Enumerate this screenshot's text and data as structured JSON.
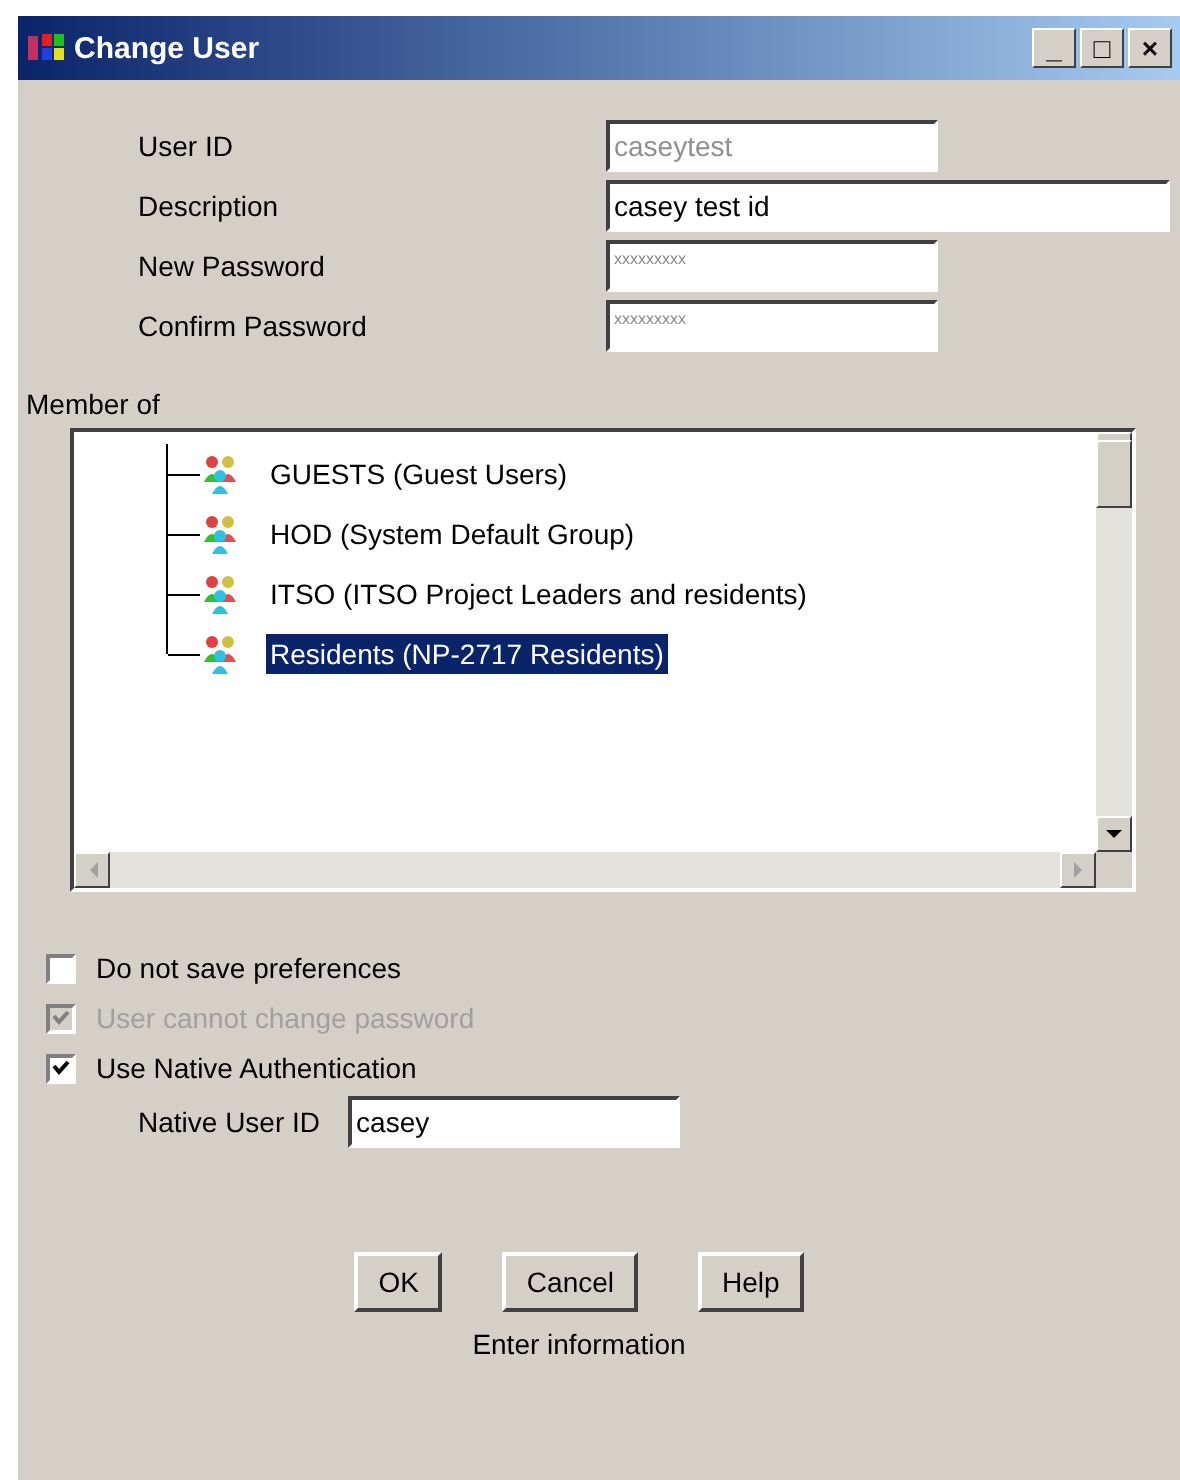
{
  "window": {
    "title": "Change User",
    "controls": [
      "_",
      "□",
      "×"
    ]
  },
  "fields": [
    {
      "label": "User ID",
      "value": "caseytest",
      "kind": "text",
      "disabled": true,
      "wide": false
    },
    {
      "label": "Description",
      "value": "casey test id",
      "kind": "text",
      "disabled": false,
      "wide": true
    },
    {
      "label": "New Password",
      "value": "xxxxxxxxx",
      "kind": "masked",
      "disabled": false,
      "wide": false
    },
    {
      "label": "Confirm Password",
      "value": "xxxxxxxxx",
      "kind": "masked",
      "disabled": false,
      "wide": false
    }
  ],
  "member_of": {
    "label": "Member of",
    "groups": [
      {
        "label": "GUESTS (Guest Users)",
        "selected": false
      },
      {
        "label": "HOD (System Default Group)",
        "selected": false
      },
      {
        "label": "ITSO (ITSO Project Leaders and residents)",
        "selected": false
      },
      {
        "label": "Residents (NP-2717 Residents)",
        "selected": true
      }
    ]
  },
  "options": [
    {
      "label": "Do not save preferences",
      "checked": false,
      "disabled": false
    },
    {
      "label": "User cannot change password",
      "checked": true,
      "disabled": true
    },
    {
      "label": "Use Native Authentication",
      "checked": true,
      "disabled": false
    }
  ],
  "native_user_id": {
    "label": "Native User ID",
    "value": "casey"
  },
  "buttons": [
    "OK",
    "Cancel",
    "Help"
  ],
  "status": "Enter information"
}
